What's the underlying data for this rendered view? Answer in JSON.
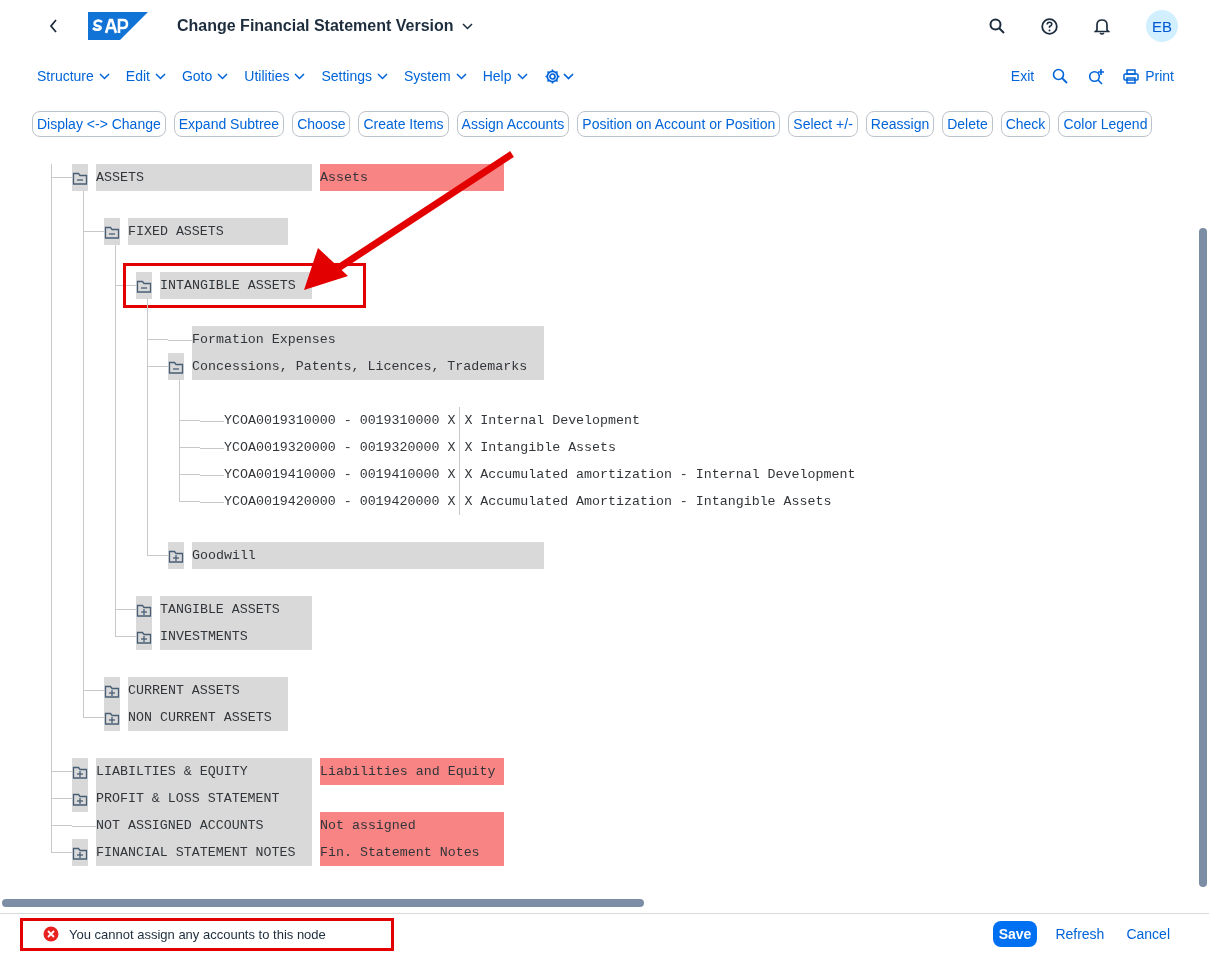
{
  "header": {
    "title": "Change Financial Statement Version",
    "avatar": "EB"
  },
  "menu": [
    "Structure",
    "Edit",
    "Goto",
    "Utilities",
    "Settings",
    "System",
    "Help"
  ],
  "menu_right": {
    "exit": "Exit",
    "print": "Print"
  },
  "toolbar": [
    "Display <-> Change",
    "Expand Subtree",
    "Choose",
    "Create Items",
    "Assign Accounts",
    "Position on Account or Position",
    "Select +/-",
    "Reassign",
    "Delete",
    "Check",
    "Color Legend"
  ],
  "tree": [
    {
      "kind": "folder",
      "label": "ASSETS",
      "description": "Assets",
      "expanded": true,
      "children": [
        {
          "kind": "folder",
          "label": "FIXED ASSETS",
          "expanded": true,
          "children": [
            {
              "kind": "folder",
              "label": "INTANGIBLE ASSETS",
              "expanded": true,
              "highlighted": true,
              "children": [
                {
                  "kind": "leaf",
                  "label": "Formation Expenses"
                },
                {
                  "kind": "folder",
                  "label": "Concessions, Patents, Licences, Trademarks",
                  "expanded": true,
                  "children": [
                    {
                      "kind": "account",
                      "key": "YCOA0019310000 - 0019310000 X",
                      "label": "X Internal Development"
                    },
                    {
                      "kind": "account",
                      "key": "YCOA0019320000 - 0019320000 X",
                      "label": "X Intangible Assets"
                    },
                    {
                      "kind": "account",
                      "key": "YCOA0019410000 - 0019410000 X",
                      "label": "X Accumulated amortization - Internal Development"
                    },
                    {
                      "kind": "account",
                      "key": "YCOA0019420000 - 0019420000 X",
                      "label": "X Accumulated Amortization - Intangible Assets"
                    }
                  ]
                },
                {
                  "kind": "folder",
                  "label": "Goodwill",
                  "expanded": false
                }
              ]
            },
            {
              "kind": "folder",
              "label": "TANGIBLE ASSETS",
              "expanded": false
            },
            {
              "kind": "folder",
              "label": "INVESTMENTS",
              "expanded": false
            }
          ]
        },
        {
          "kind": "folder",
          "label": "CURRENT ASSETS",
          "expanded": false
        },
        {
          "kind": "folder",
          "label": "NON CURRENT ASSETS",
          "expanded": false
        }
      ]
    },
    {
      "kind": "folder",
      "label": "LIABILTIES & EQUITY",
      "description": "Liabilities and Equity",
      "expanded": false
    },
    {
      "kind": "folder",
      "label": "PROFIT & LOSS STATEMENT",
      "expanded": false
    },
    {
      "kind": "leaf",
      "label": "NOT ASSIGNED ACCOUNTS",
      "description": "Not assigned"
    },
    {
      "kind": "folder",
      "label": "FINANCIAL STATEMENT NOTES",
      "description": "Fin. Statement Notes",
      "expanded": false
    }
  ],
  "message": {
    "kind": "error",
    "text": "You cannot assign any accounts to this node",
    "highlighted": true
  },
  "footer_buttons": [
    {
      "label": "Save",
      "kind": "primary"
    },
    {
      "label": "Refresh",
      "kind": "link"
    },
    {
      "label": "Cancel",
      "kind": "link"
    }
  ]
}
